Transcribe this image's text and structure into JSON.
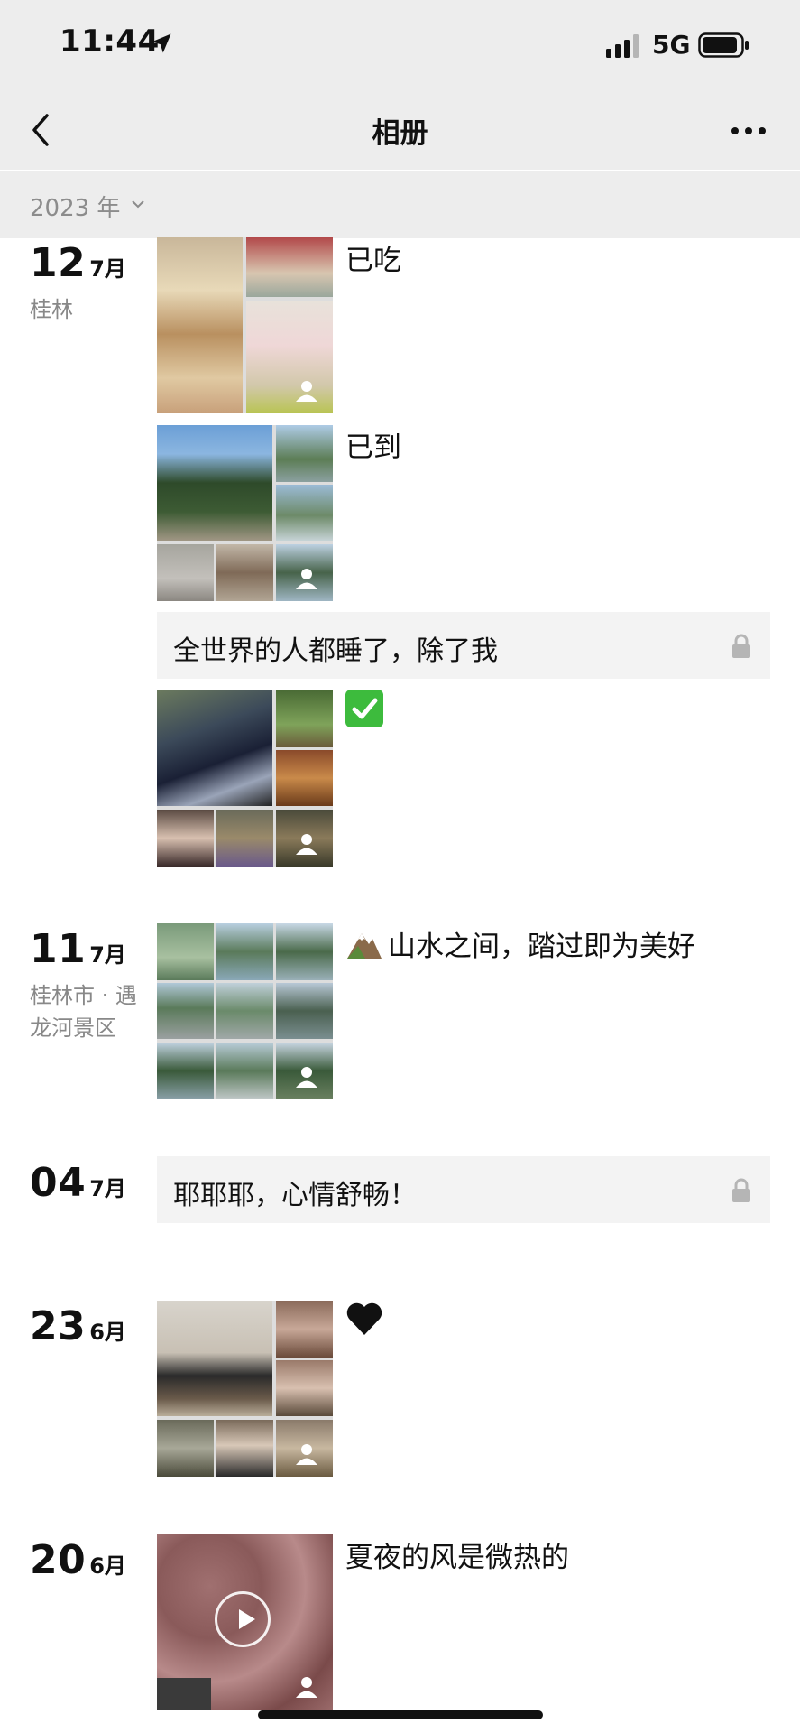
{
  "status_bar": {
    "time": "11:44",
    "network": "5G"
  },
  "nav": {
    "title": "相册"
  },
  "year_filter": {
    "label": "2023 年"
  },
  "posts": [
    {
      "day": "12",
      "month": "7月",
      "place": "桂林",
      "caption": "已吃"
    },
    {
      "caption": "已到"
    },
    {
      "text": "全世界的人都睡了，除了我"
    },
    {
      "caption_icon": "check-emoji"
    },
    {
      "day": "11",
      "month": "7月",
      "place": "桂林市 · 遇龙河景区",
      "caption": "山水之间，踏过即为美好",
      "caption_icon": "mountain-emoji"
    },
    {
      "day": "04",
      "month": "7月",
      "text": "耶耶耶，心情舒畅！"
    },
    {
      "day": "23",
      "month": "6月",
      "caption_icon": "black-heart-emoji"
    },
    {
      "day": "20",
      "month": "6月",
      "caption": "夏夜的风是微热的"
    }
  ]
}
